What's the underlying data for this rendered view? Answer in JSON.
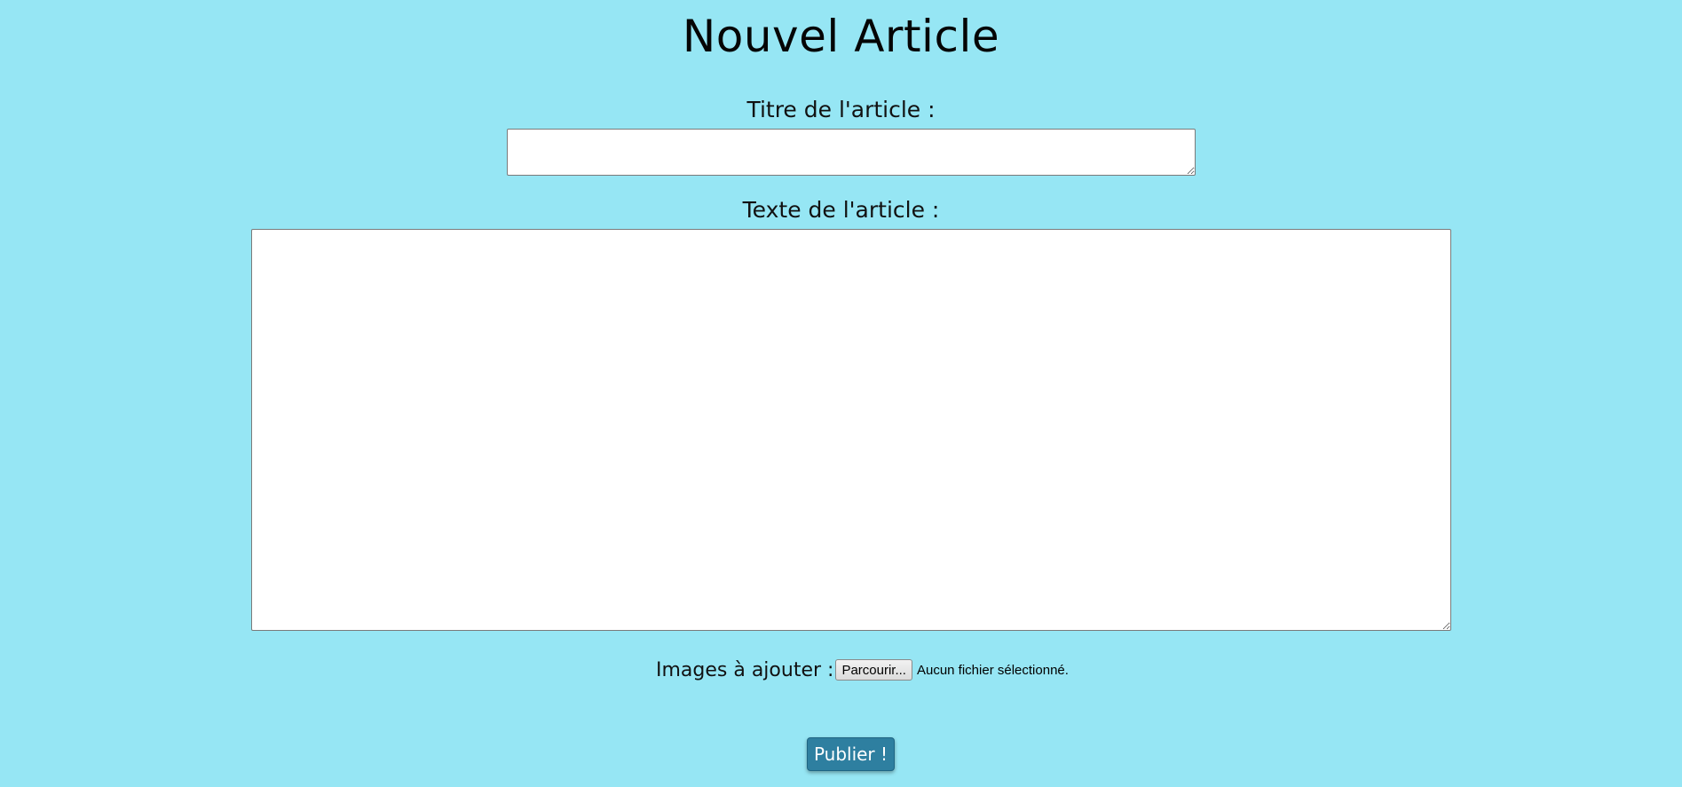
{
  "page": {
    "title": "Nouvel Article",
    "background_color": "#96e6f4"
  },
  "form": {
    "title_label": "Titre de l'article :",
    "title_value": "",
    "text_label": "Texte de l'article :",
    "text_value": "",
    "images_label": "Images à ajouter :",
    "browse_button_label": "Parcourir...",
    "file_status": "Aucun fichier sélectionné.",
    "submit_label": "Publier !",
    "submit_color": "#2e7fa0"
  }
}
